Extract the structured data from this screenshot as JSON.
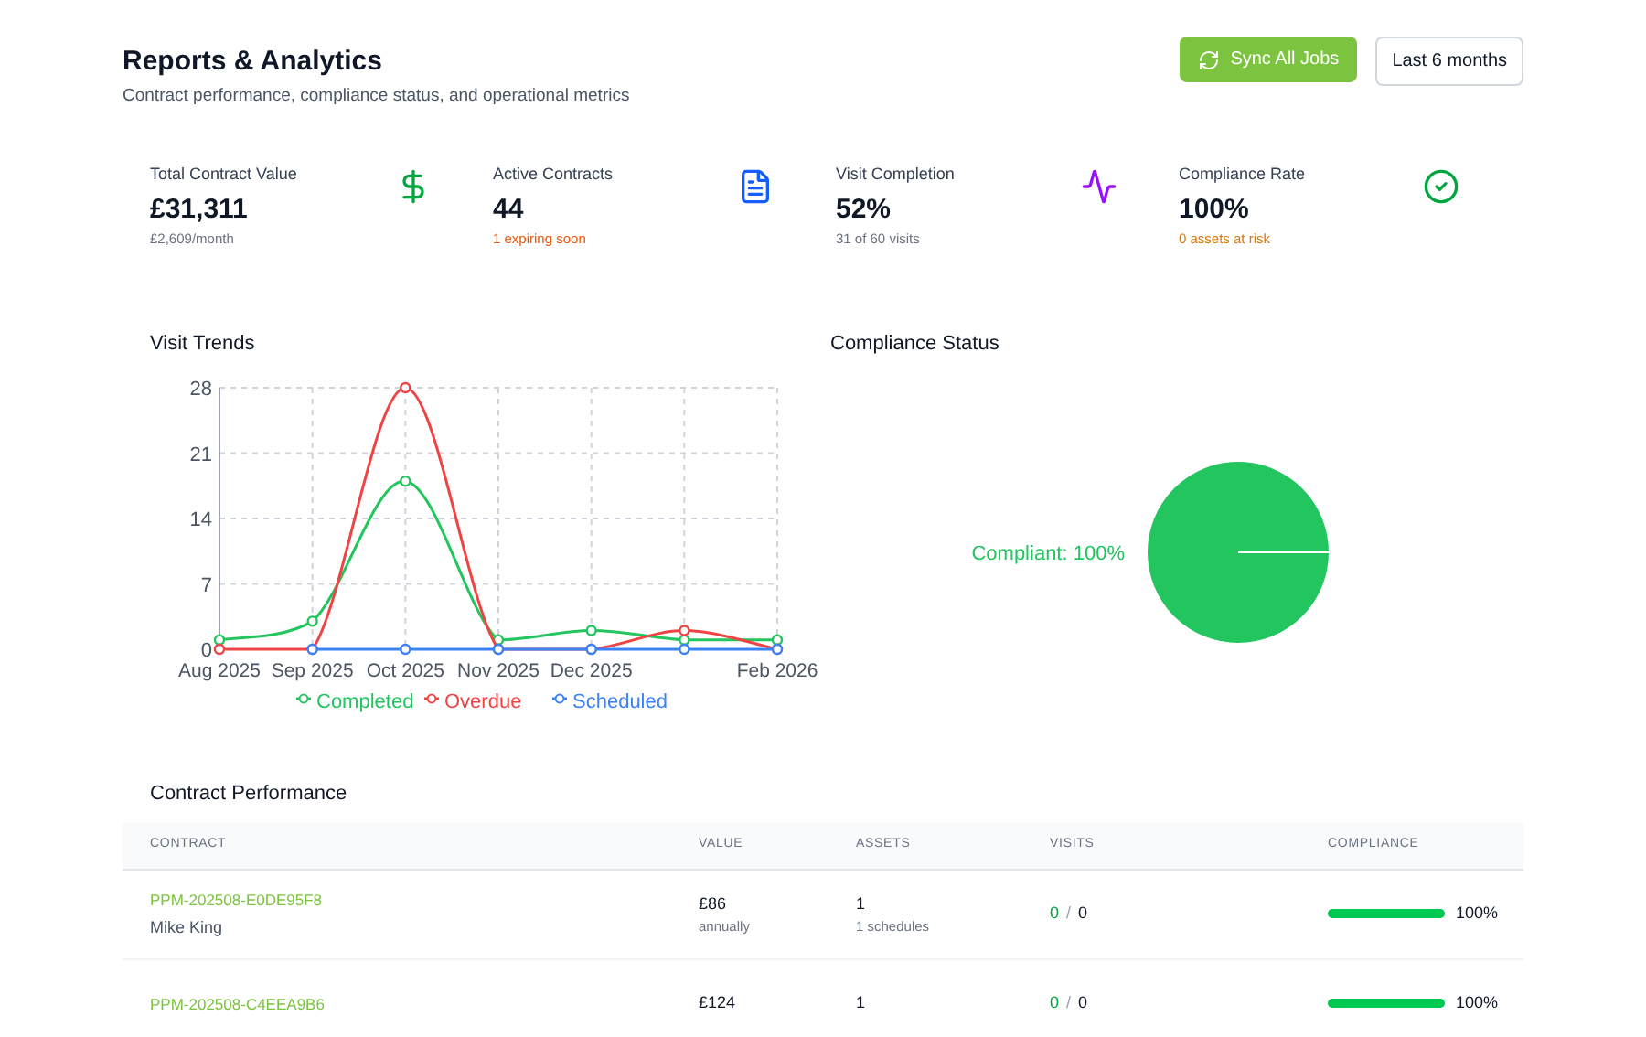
{
  "header": {
    "title": "Reports & Analytics",
    "subtitle": "Contract performance, compliance status, and operational metrics",
    "sync_button": "Sync All Jobs",
    "period_select": "Last 6 months"
  },
  "kpis": [
    {
      "kind": "money",
      "label": "Total Contract Value",
      "value": "£31,311",
      "note": "£2,609/month",
      "color": "#6b7280"
    },
    {
      "kind": "document",
      "label": "Active Contracts",
      "value": "44",
      "note": "1 expiring soon",
      "color": "#ea580c"
    },
    {
      "kind": "activity",
      "label": "Visit Completion",
      "value": "52%",
      "note": "31 of 60 visits",
      "color": "#6b7280"
    },
    {
      "kind": "check",
      "label": "Compliance Rate",
      "value": "100%",
      "note": "0 assets at risk",
      "color": "#d97706"
    }
  ],
  "visit_trends": {
    "title": "Visit Trends",
    "chart_data": {
      "type": "line",
      "categories": [
        "Aug 2025",
        "Sep 2025",
        "Oct 2025",
        "Nov 2025",
        "Dec 2025",
        null,
        "Feb 2026"
      ],
      "yticks": [
        0,
        7,
        14,
        21,
        28
      ],
      "ylim": [
        0,
        28
      ],
      "grid": true,
      "legend": true,
      "series": [
        {
          "name": "Completed",
          "color": "#22c55e",
          "marker": "circle",
          "values": [
            1,
            3,
            18,
            1,
            2,
            1,
            1
          ]
        },
        {
          "name": "Overdue",
          "color": "#ef4444",
          "marker": "circle",
          "values": [
            0,
            0,
            28,
            0,
            0,
            2,
            0
          ]
        },
        {
          "name": "Scheduled",
          "color": "#3b82f6",
          "marker": "circle",
          "values": [
            null,
            0,
            0,
            0,
            0,
            0,
            0
          ]
        }
      ]
    }
  },
  "compliance_status": {
    "title": "Compliance Status",
    "chart_data": {
      "type": "pie",
      "categories": [
        "Compliant"
      ],
      "values": [
        100
      ],
      "value_labels": [
        "100%"
      ]
    }
  },
  "contract_performance": {
    "title": "Contract Performance",
    "columns": [
      "CONTRACT",
      "VALUE",
      "ASSETS",
      "VISITS",
      "COMPLIANCE"
    ],
    "rows": [
      {
        "contract": "PPM-202508-E0DE95F8",
        "client": "Mike King",
        "value": "£86",
        "period": "annually",
        "assets": "1",
        "schedules": "1 schedules",
        "visits_done": "0",
        "visits_separator": "/",
        "visits_total": "0",
        "level": 1,
        "compliance": "100%"
      },
      {
        "contract": "PPM-202508-C4EEA9B6",
        "value": "£124",
        "assets": "1",
        "visits_done": "0",
        "visits_separator": "/",
        "visits_total": "0",
        "level": 1,
        "compliance": "100%"
      }
    ]
  }
}
